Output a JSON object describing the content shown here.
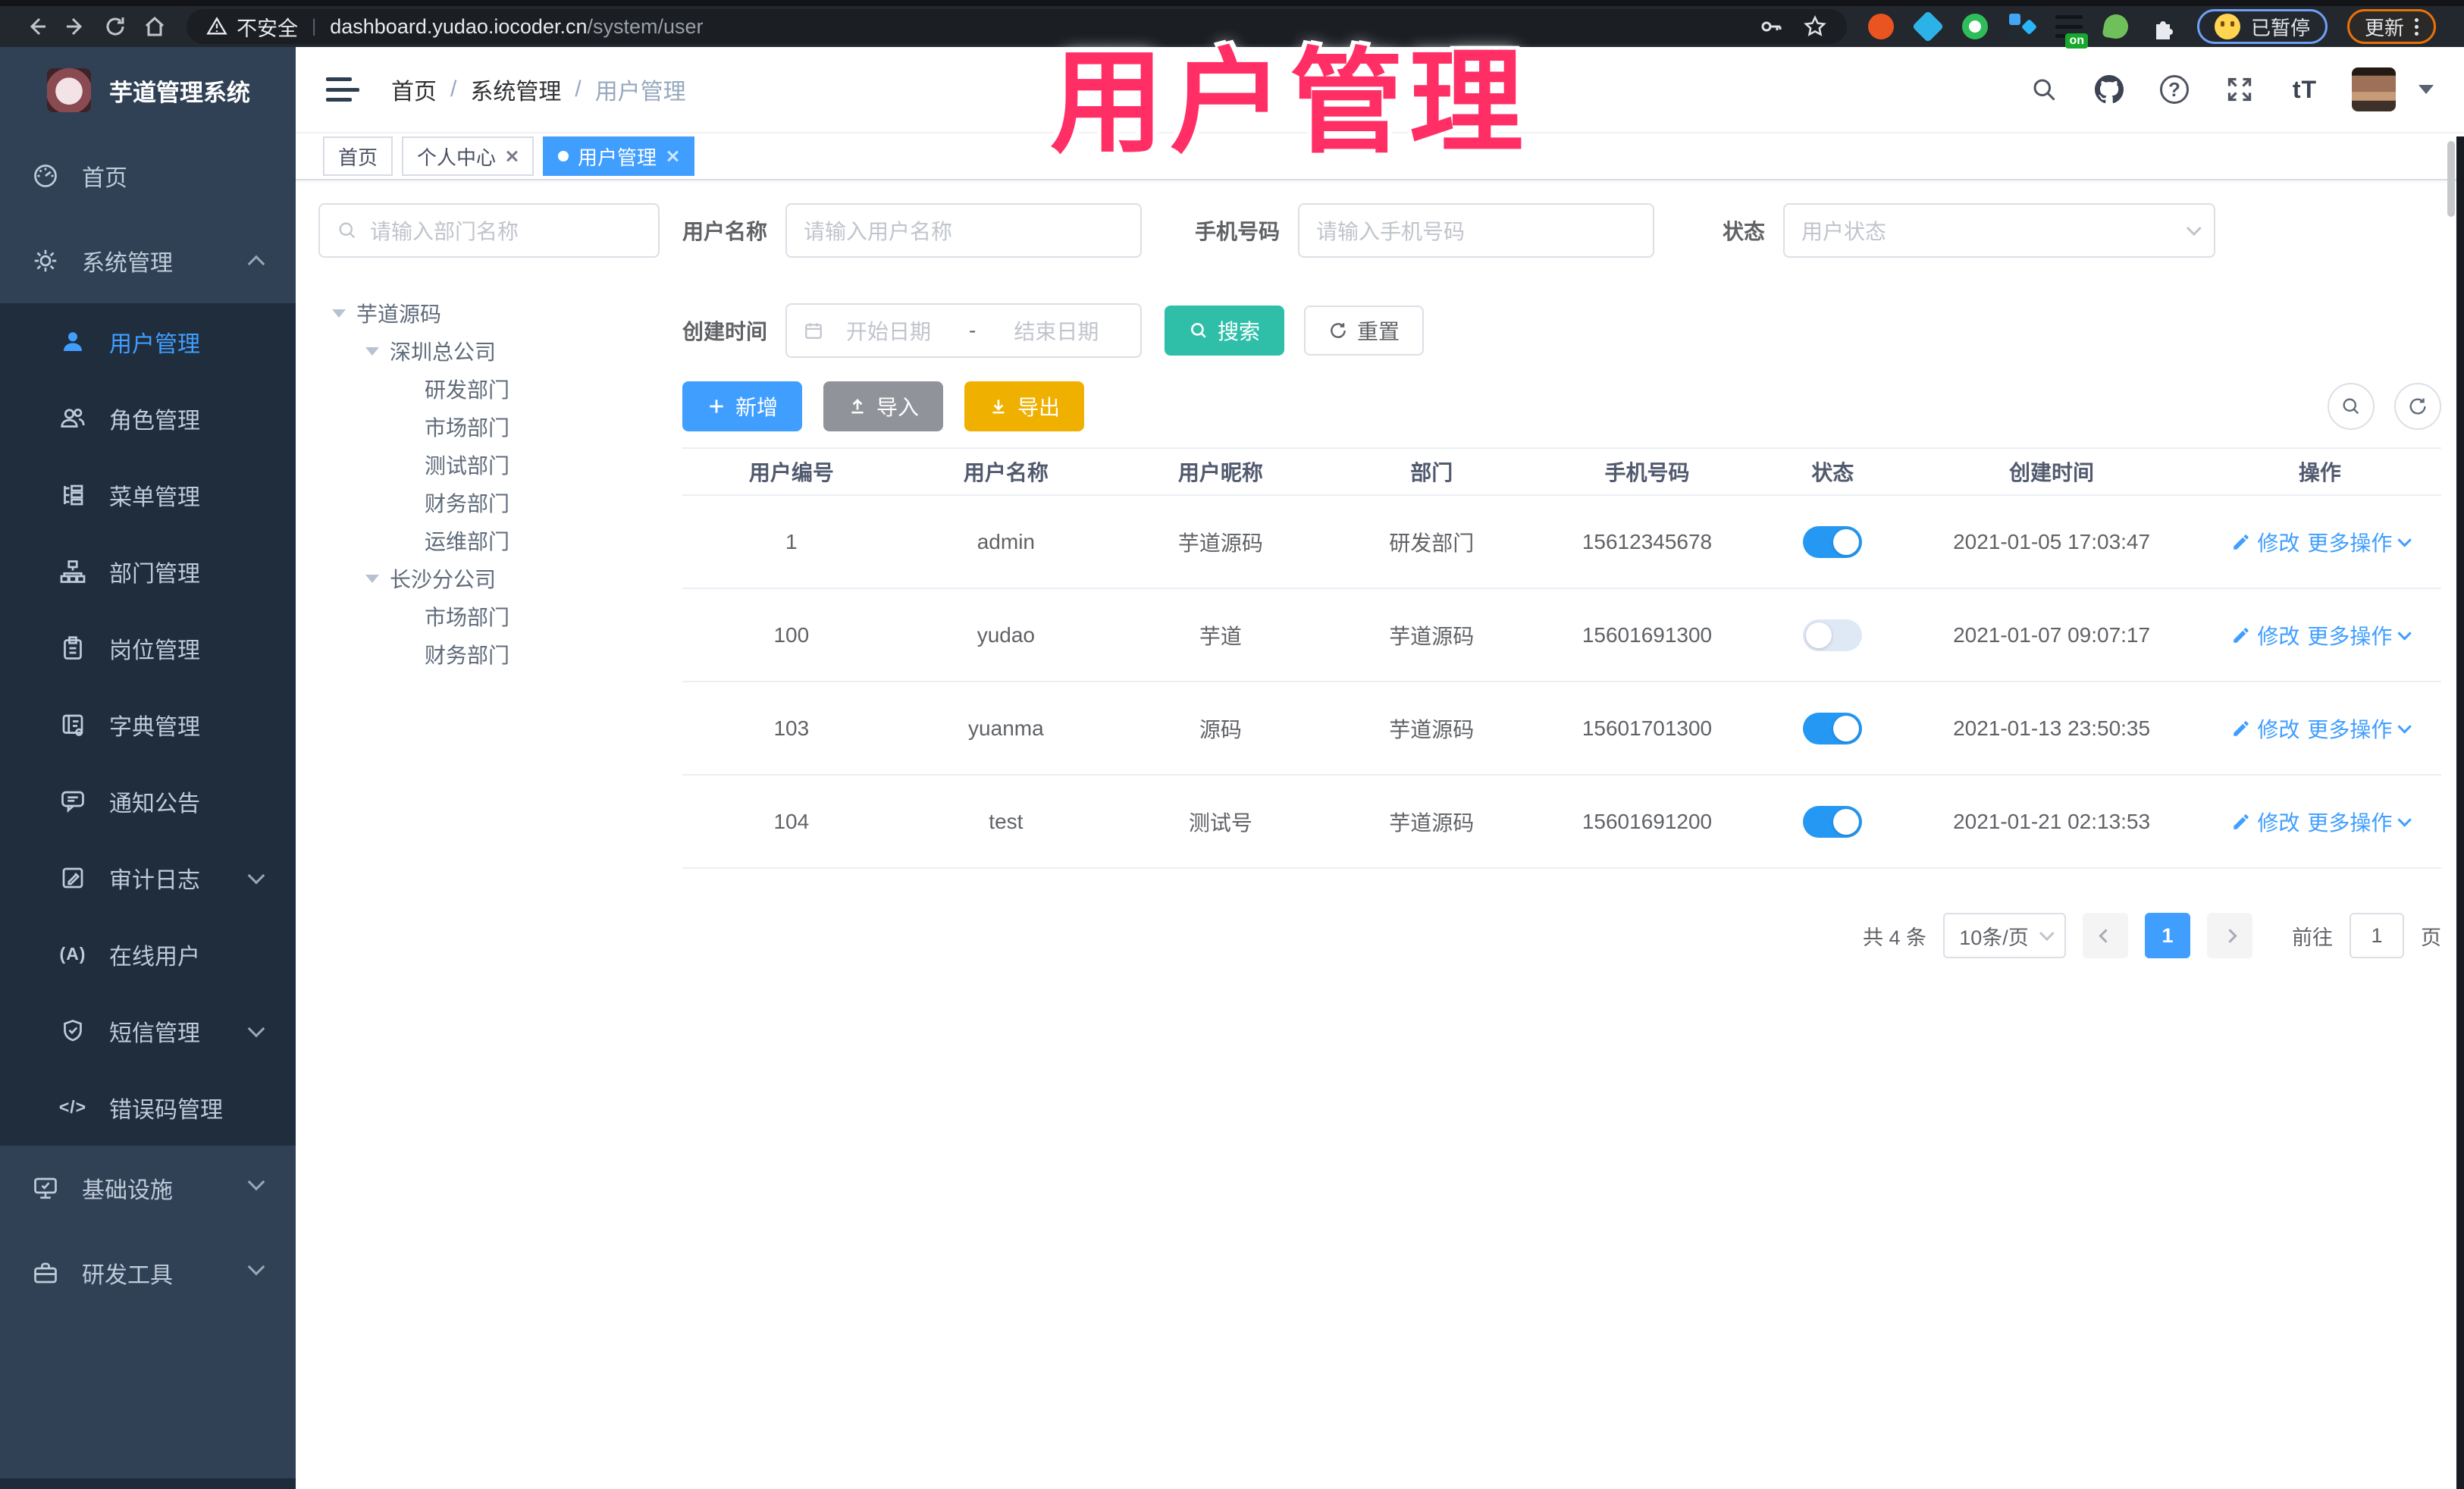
{
  "overlay": {
    "text": "用户管理",
    "color": "#ff2f66"
  },
  "browser": {
    "security_label": "不安全",
    "url_host": "dashboard.yudao.iocoder.cn",
    "url_path": "/system/user",
    "ext_badge_on": "on",
    "profile_status": "已暂停",
    "update_label": "更新"
  },
  "sidebar": {
    "title": "芋道管理系统",
    "items": [
      {
        "label": "首页",
        "icon": "dashboard-icon",
        "level": "top"
      },
      {
        "label": "系统管理",
        "icon": "gear-icon",
        "level": "top",
        "expanded": true
      },
      {
        "label": "用户管理",
        "icon": "user-icon",
        "level": "sub",
        "active": true
      },
      {
        "label": "角色管理",
        "icon": "roles-icon",
        "level": "sub"
      },
      {
        "label": "菜单管理",
        "icon": "menu-tree-icon",
        "level": "sub"
      },
      {
        "label": "部门管理",
        "icon": "org-icon",
        "level": "sub"
      },
      {
        "label": "岗位管理",
        "icon": "post-icon",
        "level": "sub"
      },
      {
        "label": "字典管理",
        "icon": "dict-icon",
        "level": "sub"
      },
      {
        "label": "通知公告",
        "icon": "announce-icon",
        "level": "sub"
      },
      {
        "label": "审计日志",
        "icon": "log-icon",
        "level": "sub",
        "collapsed": true
      },
      {
        "label": "在线用户",
        "icon": "online-icon",
        "icon_text": "(A)",
        "level": "sub"
      },
      {
        "label": "短信管理",
        "icon": "sms-shield-icon",
        "level": "sub",
        "collapsed": true
      },
      {
        "label": "错误码管理",
        "icon": "code-icon",
        "icon_text": "</>",
        "level": "sub"
      },
      {
        "label": "基础设施",
        "icon": "infra-icon",
        "level": "top",
        "collapsed": true
      },
      {
        "label": "研发工具",
        "icon": "tools-icon",
        "level": "top",
        "collapsed": true
      }
    ]
  },
  "topnav": {
    "breadcrumb": [
      "首页",
      "系统管理",
      "用户管理"
    ],
    "separator": "/",
    "help_icon_text": "?",
    "font_icon_text": "tT"
  },
  "tabs": [
    {
      "label": "首页",
      "closable": false,
      "active": false
    },
    {
      "label": "个人中心",
      "closable": true,
      "active": false
    },
    {
      "label": "用户管理",
      "closable": true,
      "active": true
    }
  ],
  "filters": {
    "dept_search_placeholder": "请输入部门名称",
    "username_label": "用户名称",
    "username_placeholder": "请输入用户名称",
    "mobile_label": "手机号码",
    "mobile_placeholder": "请输入手机号码",
    "status_label": "状态",
    "status_placeholder": "用户状态",
    "create_time_label": "创建时间",
    "date_start_placeholder": "开始日期",
    "date_separator": "-",
    "date_end_placeholder": "结束日期",
    "search_button": "搜索",
    "reset_button": "重置"
  },
  "tree": {
    "nodes": [
      {
        "label": "芋道源码",
        "depth": 0,
        "expandable": true
      },
      {
        "label": "深圳总公司",
        "depth": 1,
        "expandable": true
      },
      {
        "label": "研发部门",
        "depth": 2
      },
      {
        "label": "市场部门",
        "depth": 2
      },
      {
        "label": "测试部门",
        "depth": 2
      },
      {
        "label": "财务部门",
        "depth": 2
      },
      {
        "label": "运维部门",
        "depth": 2
      },
      {
        "label": "长沙分公司",
        "depth": 1,
        "expandable": true
      },
      {
        "label": "市场部门",
        "depth": 2
      },
      {
        "label": "财务部门",
        "depth": 2
      }
    ]
  },
  "toolbar": {
    "add_button": "新增",
    "import_button": "导入",
    "export_button": "导出"
  },
  "table": {
    "columns": [
      "用户编号",
      "用户名称",
      "用户昵称",
      "部门",
      "手机号码",
      "状态",
      "创建时间",
      "操作"
    ],
    "actions": {
      "edit": "修改",
      "more": "更多操作"
    },
    "rows": [
      {
        "id": "1",
        "username": "admin",
        "nickname": "芋道源码",
        "dept": "研发部门",
        "mobile": "15612345678",
        "status": "on",
        "created": "2021-01-05 17:03:47"
      },
      {
        "id": "100",
        "username": "yudao",
        "nickname": "芋道",
        "dept": "芋道源码",
        "mobile": "15601691300",
        "status": "off",
        "created": "2021-01-07 09:07:17"
      },
      {
        "id": "103",
        "username": "yuanma",
        "nickname": "源码",
        "dept": "芋道源码",
        "mobile": "15601701300",
        "status": "on",
        "created": "2021-01-13 23:50:35"
      },
      {
        "id": "104",
        "username": "test",
        "nickname": "测试号",
        "dept": "芋道源码",
        "mobile": "15601691200",
        "status": "on",
        "created": "2021-01-21 02:13:53"
      }
    ]
  },
  "pagination": {
    "total_text": "共 4 条",
    "page_size": "10条/页",
    "current_page": "1",
    "goto_label": "前往",
    "goto_value": "1",
    "page_unit": "页"
  },
  "colors": {
    "accent_blue": "#409eff",
    "search_teal": "#2fbfa9",
    "export_yellow": "#f0b000",
    "import_gray": "#909399",
    "toggle_on_blue": "#2598f3",
    "sidebar_bg": "#304156",
    "submenu_bg": "#1f2d3d",
    "overlay_pink": "#ff2f66"
  }
}
